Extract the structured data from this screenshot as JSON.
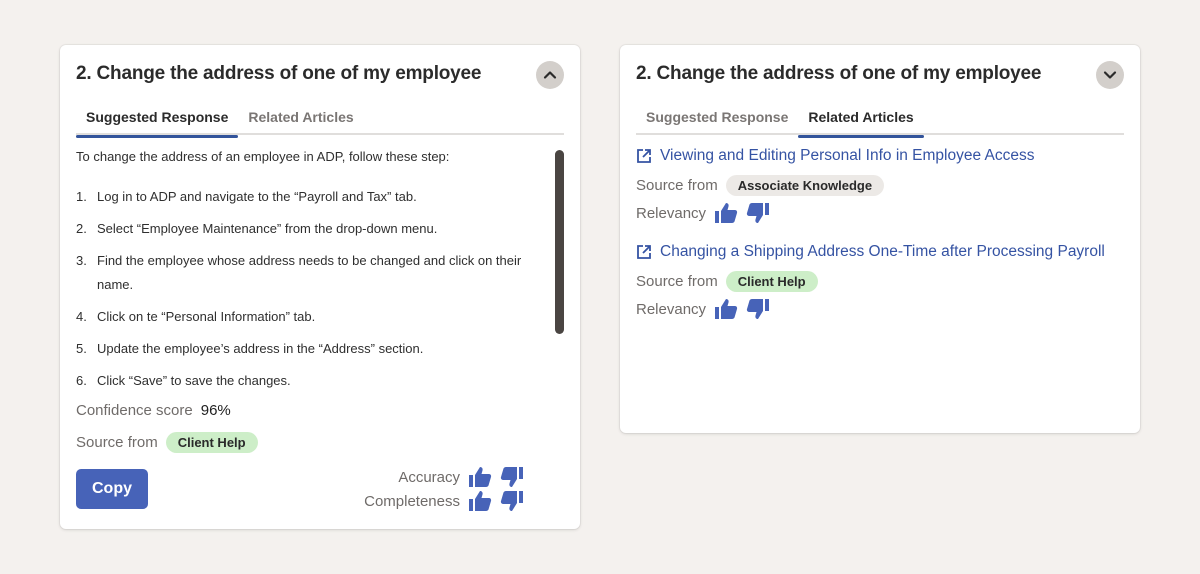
{
  "colors": {
    "accent": "#33549b",
    "copy_button": "#4763b8",
    "badge_green": "#cdeec8",
    "badge_gray": "#ece9e6",
    "link": "#3553a3"
  },
  "left_card": {
    "title": "2. Change the address of one of my employee",
    "toggle_icon": "chevron-up-icon",
    "tabs": [
      {
        "label": "Suggested Response",
        "active": true
      },
      {
        "label": "Related Articles",
        "active": false
      }
    ],
    "intro": "To change the address of an employee in ADP, follow these step:",
    "steps": [
      {
        "num": "1.",
        "text": "Log in to ADP and navigate to the “Payroll and Tax” tab."
      },
      {
        "num": "2.",
        "text": "Select “Employee Maintenance” from the drop-down menu."
      },
      {
        "num": "3.",
        "text": "Find the employee whose address needs to be changed and click on their name."
      },
      {
        "num": "4.",
        "text": "Click on te “Personal Information” tab."
      },
      {
        "num": "5.",
        "text": "Update the employee’s address in the “Address” section."
      },
      {
        "num": "6.",
        "text": "Click “Save” to save the changes."
      }
    ],
    "confidence_label": "Confidence score",
    "confidence_value": "96%",
    "source_label": "Source from",
    "source_badge": "Client Help",
    "copy_label": "Copy",
    "accuracy_label": "Accuracy",
    "completeness_label": "Completeness"
  },
  "right_card": {
    "title": "2. Change the address of one of my employee",
    "toggle_icon": "chevron-down-icon",
    "tabs": [
      {
        "label": "Suggested Response",
        "active": false
      },
      {
        "label": "Related Articles",
        "active": true
      }
    ],
    "articles": [
      {
        "title": "Viewing and Editing Personal Info in Employee Access",
        "source_label": "Source from",
        "source": "Associate Knowledge",
        "relevancy_label": "Relevancy"
      },
      {
        "title": "Changing a Shipping Address One-Time after Processing Payroll",
        "source_label": "Source from",
        "source": "Client Help",
        "relevancy_label": "Relevancy"
      }
    ]
  }
}
